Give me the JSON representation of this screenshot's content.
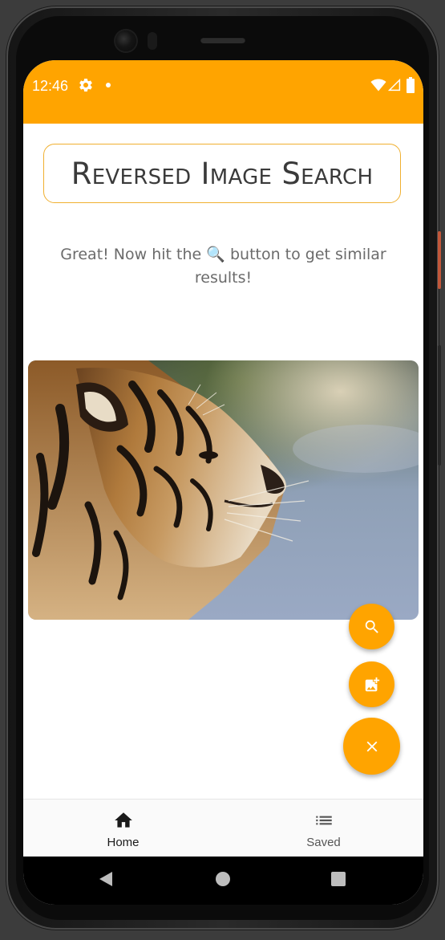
{
  "status_bar": {
    "time": "12:46",
    "background_color": "#ffa400",
    "icons": [
      "gear-icon",
      "dot-icon",
      "wifi-icon",
      "signal-icon",
      "battery-icon"
    ]
  },
  "header": {
    "title": "Reversed Image Search"
  },
  "main": {
    "instruction_prefix": "Great! Now hit the ",
    "instruction_icon": "🔍",
    "instruction_suffix": " button to get similar results!",
    "selected_image": {
      "subject": "tiger",
      "icon": "image"
    }
  },
  "fabs": {
    "accent_color": "#ffa400",
    "items": [
      {
        "name": "search",
        "icon": "search-icon"
      },
      {
        "name": "add-image",
        "icon": "add-photo-icon"
      },
      {
        "name": "close",
        "icon": "close-icon"
      }
    ]
  },
  "bottom_nav": {
    "items": [
      {
        "label": "Home",
        "icon": "home-icon",
        "selected": true
      },
      {
        "label": "Saved",
        "icon": "list-icon",
        "selected": false
      }
    ]
  },
  "system_nav": {
    "buttons": [
      "back-icon",
      "home-circle-icon",
      "recents-icon"
    ]
  }
}
